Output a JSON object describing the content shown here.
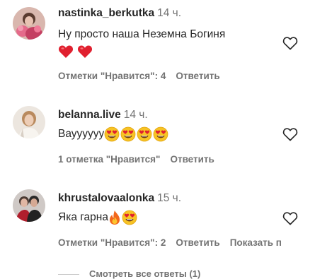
{
  "comments": [
    {
      "username": "nastinka_berkutka",
      "time": "14 ч.",
      "text": "Ну просто наша Неземна Богиня",
      "likes_label": "Отметки \"Нравится\": 4",
      "reply_label": "Ответить",
      "emojis": [
        "red-heart",
        "red-heart"
      ]
    },
    {
      "username": "belanna.live",
      "time": "14 ч.",
      "text": "Вауууууу",
      "likes_label": "1 отметка \"Нравится\"",
      "reply_label": "Ответить",
      "emojis": [
        "heart-eyes",
        "heart-eyes",
        "heart-eyes",
        "heart-eyes"
      ]
    },
    {
      "username": "khrustalovaalonka",
      "time": "15 ч.",
      "text": "Яка гарна",
      "likes_label": "Отметки \"Нравится\": 2",
      "reply_label": "Ответить",
      "show_label": "Показать п",
      "emojis": [
        "fire",
        "heart-eyes"
      ]
    }
  ],
  "view_replies_label": "Смотреть все ответы (1)",
  "colors": {
    "text": "#262626",
    "secondary": "#737373",
    "heart": "#e0202f",
    "emoji_face": "#f7c325"
  },
  "icons": {
    "like": "heart-outline-icon"
  }
}
